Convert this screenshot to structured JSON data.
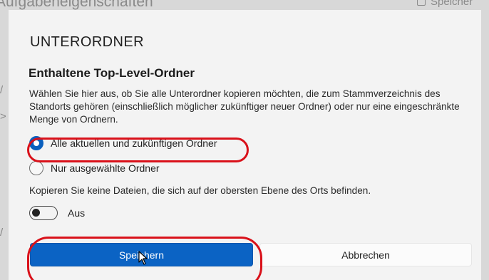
{
  "background": {
    "title": "Aufgabeneigenschaften",
    "save_label": "Speicher"
  },
  "dialog": {
    "title": "UNTERORDNER",
    "section_heading": "Enthaltene Top-Level-Ordner",
    "description": "Wählen Sie hier aus, ob Sie alle Unterordner kopieren möchten, die zum Stammverzeichnis des Standorts gehören (einschließlich möglicher zukünftiger neuer Ordner) oder nur eine eingeschränkte Menge von Ordnern.",
    "options": [
      {
        "label": "Alle aktuellen und zukünftigen Ordner",
        "selected": true
      },
      {
        "label": "Nur ausgewählte Ordner",
        "selected": false
      }
    ],
    "files_info": "Kopieren Sie keine Dateien, die sich auf der obersten Ebene des Orts befinden.",
    "toggle": {
      "label": "Aus",
      "on": false
    },
    "buttons": {
      "save": "Speichern",
      "cancel": "Abbrechen"
    }
  },
  "colors": {
    "accent": "#0b63c4",
    "annotation": "#d9111a"
  }
}
